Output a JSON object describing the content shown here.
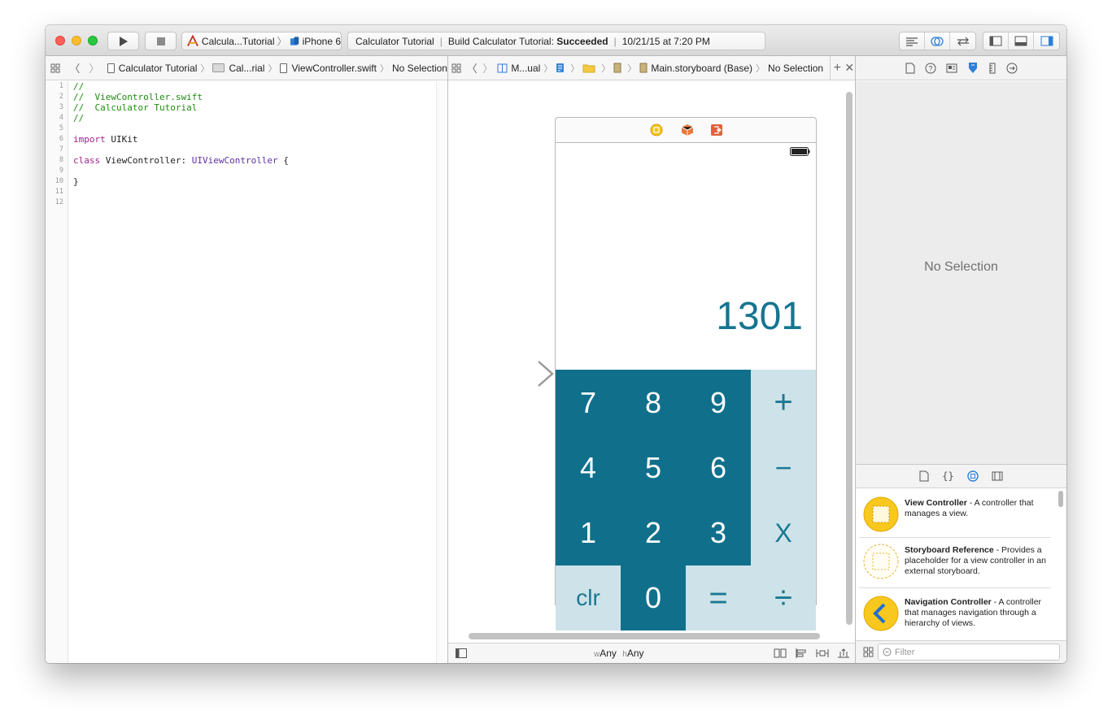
{
  "toolbar": {
    "scheme_target": "Calcula...Tutorial",
    "device": "iPhone 6",
    "status_project": "Calculator Tutorial",
    "status_build_prefix": "Build Calculator Tutorial:",
    "status_build_result": "Succeeded",
    "status_time": "10/21/15 at 7:20 PM"
  },
  "left_jumpbar": {
    "crumbs": [
      "Calculator Tutorial",
      "Cal...rial",
      "ViewController.swift",
      "No Selection"
    ]
  },
  "right_jumpbar": {
    "crumbs": [
      "M...ual",
      "Main.storyboard (Base)",
      "No Selection"
    ]
  },
  "code": {
    "line_numbers": [
      "1",
      "2",
      "3",
      "4",
      "5",
      "6",
      "7",
      "8",
      "9",
      "10",
      "11",
      "12"
    ],
    "lines": [
      {
        "comment": "//"
      },
      {
        "comment": "//  ViewController.swift"
      },
      {
        "comment": "//  Calculator Tutorial"
      },
      {
        "comment": "//"
      },
      {},
      {
        "kw": "import",
        "rest": " UIKit"
      },
      {},
      {
        "kw": "class",
        "rest": " ViewController: ",
        "type": "UIViewController",
        "tail": " {"
      },
      {},
      {
        "rest": "}"
      },
      {},
      {}
    ]
  },
  "calculator": {
    "display": "1301",
    "keys": {
      "k7": "7",
      "k8": "8",
      "k9": "9",
      "plus": "+",
      "k4": "4",
      "k5": "5",
      "k6": "6",
      "minus": "−",
      "k1": "1",
      "k2": "2",
      "k3": "3",
      "times": "X",
      "clr": "clr",
      "k0": "0",
      "equals": "=",
      "divide": "÷"
    }
  },
  "canvas_bottom": {
    "w_prefix": "w",
    "w_value": "Any",
    "h_prefix": "h",
    "h_value": "Any"
  },
  "inspector": {
    "no_selection": "No Selection"
  },
  "library": {
    "items": [
      {
        "title": "View Controller",
        "desc": " - A controller that manages a view."
      },
      {
        "title": "Storyboard Reference",
        "desc": " - Provides a placeholder for a view controller in an external storyboard."
      },
      {
        "title": "Navigation Controller",
        "desc": " - A controller that manages navigation through a hierarchy of views."
      }
    ],
    "filter_placeholder": "Filter"
  },
  "colors": {
    "key_dark": "#10708c",
    "key_light": "#cde3e9",
    "display_text": "#157590",
    "code_comment": "#1f8a11",
    "code_keyword": "#a2218c",
    "code_type": "#5f2fa3"
  }
}
